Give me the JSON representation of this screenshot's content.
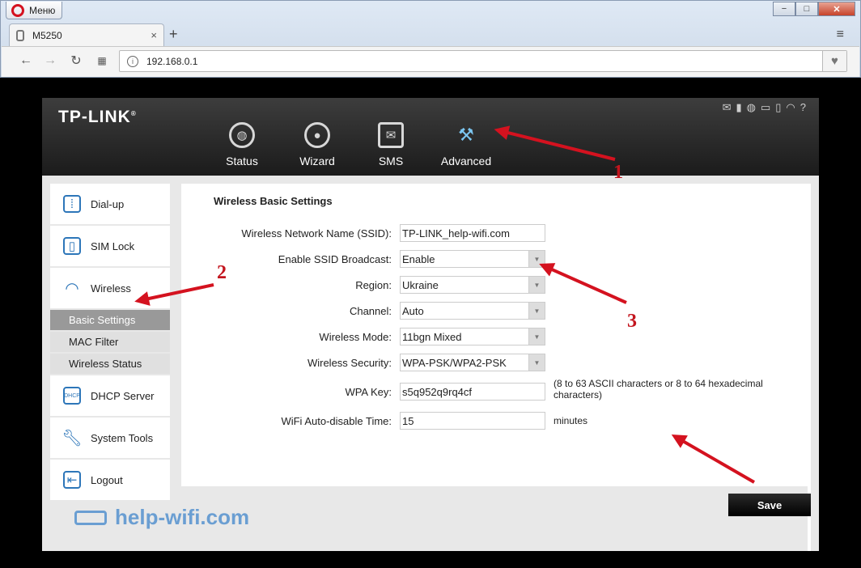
{
  "browser": {
    "menu_label": "Меню",
    "tab_title": "M5250",
    "tab_close": "×",
    "new_tab": "+",
    "tab_menu": "≡",
    "url": "192.168.0.1",
    "win_min": "−",
    "win_max": "□",
    "win_close": "✕"
  },
  "router": {
    "logo": "TP-LINK",
    "logo_mark": "®",
    "nav": [
      {
        "label": "Status",
        "icon": "globe-icon"
      },
      {
        "label": "Wizard",
        "icon": "gear-icon"
      },
      {
        "label": "SMS",
        "icon": "envelope-icon"
      },
      {
        "label": "Advanced",
        "icon": "tools-icon"
      }
    ],
    "status_icons": [
      "envelope-icon",
      "signal-icon",
      "globe-icon",
      "battery-icon",
      "sim-icon",
      "wifi-icon",
      "help-icon"
    ],
    "sidebar": {
      "items": [
        {
          "label": "Dial-up",
          "icon": "dialpad-icon"
        },
        {
          "label": "SIM Lock",
          "icon": "sim-lock-icon"
        },
        {
          "label": "Wireless",
          "icon": "wifi-icon"
        },
        {
          "label": "DHCP Server",
          "icon": "dhcp-icon"
        },
        {
          "label": "System Tools",
          "icon": "wrench-icon"
        },
        {
          "label": "Logout",
          "icon": "logout-icon"
        }
      ],
      "wireless_sub": [
        "Basic Settings",
        "MAC Filter",
        "Wireless Status"
      ]
    },
    "content": {
      "title": "Wireless Basic Settings",
      "fields": [
        {
          "label": "Wireless Network Name (SSID):",
          "value": "TP-LINK_help-wifi.com",
          "type": "text"
        },
        {
          "label": "Enable SSID Broadcast:",
          "value": "Enable",
          "type": "select"
        },
        {
          "label": "Region:",
          "value": "Ukraine",
          "type": "select"
        },
        {
          "label": "Channel:",
          "value": "Auto",
          "type": "select"
        },
        {
          "label": "Wireless Mode:",
          "value": "11bgn Mixed",
          "type": "select"
        },
        {
          "label": "Wireless Security:",
          "value": "WPA-PSK/WPA2-PSK",
          "type": "select"
        },
        {
          "label": "WPA Key:",
          "value": "s5q952q9rq4cf",
          "type": "text"
        },
        {
          "label": "WiFi Auto-disable Time:",
          "value": "15",
          "type": "text"
        }
      ],
      "wpa_hint": "(8 to 63 ASCII characters or 8 to 64 hexadecimal characters)",
      "minutes": "minutes",
      "save": "Save"
    }
  },
  "watermark": "help-wifi.com",
  "annotations": [
    "1",
    "2",
    "3"
  ],
  "colors": {
    "arrow": "#d4121f",
    "accent_blue": "#2d76b9"
  }
}
